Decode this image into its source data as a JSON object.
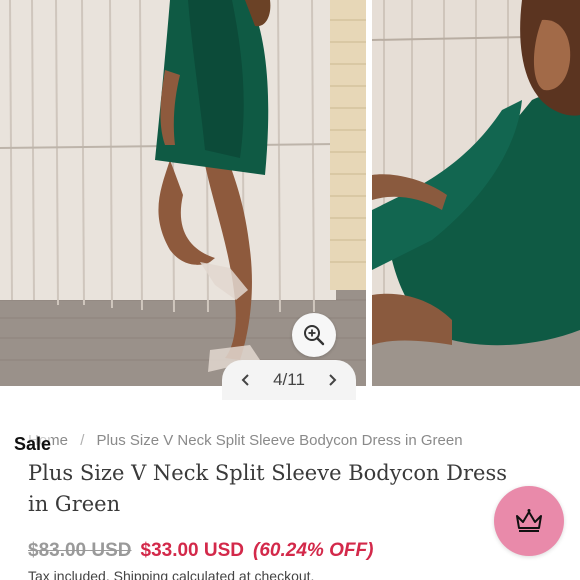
{
  "gallery": {
    "pager": {
      "current": 4,
      "total": 11,
      "label": "4/11"
    },
    "images": [
      {
        "alt": "model-standing-green-dress"
      },
      {
        "alt": "model-seated-green-dress"
      }
    ]
  },
  "sale_label": "Sale",
  "breadcrumb": {
    "home": "Home",
    "separator": "/",
    "current": "Plus Size V Neck Split Sleeve Bodycon Dress in Green"
  },
  "product": {
    "title": "Plus Size V Neck Split Sleeve Bodycon Dress in Green",
    "compare_price": "$83.00 USD",
    "price": "$33.00 USD",
    "discount": "(60.24% OFF)",
    "tax_note_prefix": "Tax included. ",
    "tax_note_link": "Shipping",
    "tax_note_suffix": " calculated at checkout."
  },
  "colors": {
    "accent": "#d3294a",
    "dress": "#0f5a44",
    "rewards": "#e98aaa"
  },
  "icons": {
    "zoom": "magnify-plus-icon",
    "prev": "chevron-left-icon",
    "next": "chevron-right-icon",
    "rewards": "crown-icon"
  }
}
